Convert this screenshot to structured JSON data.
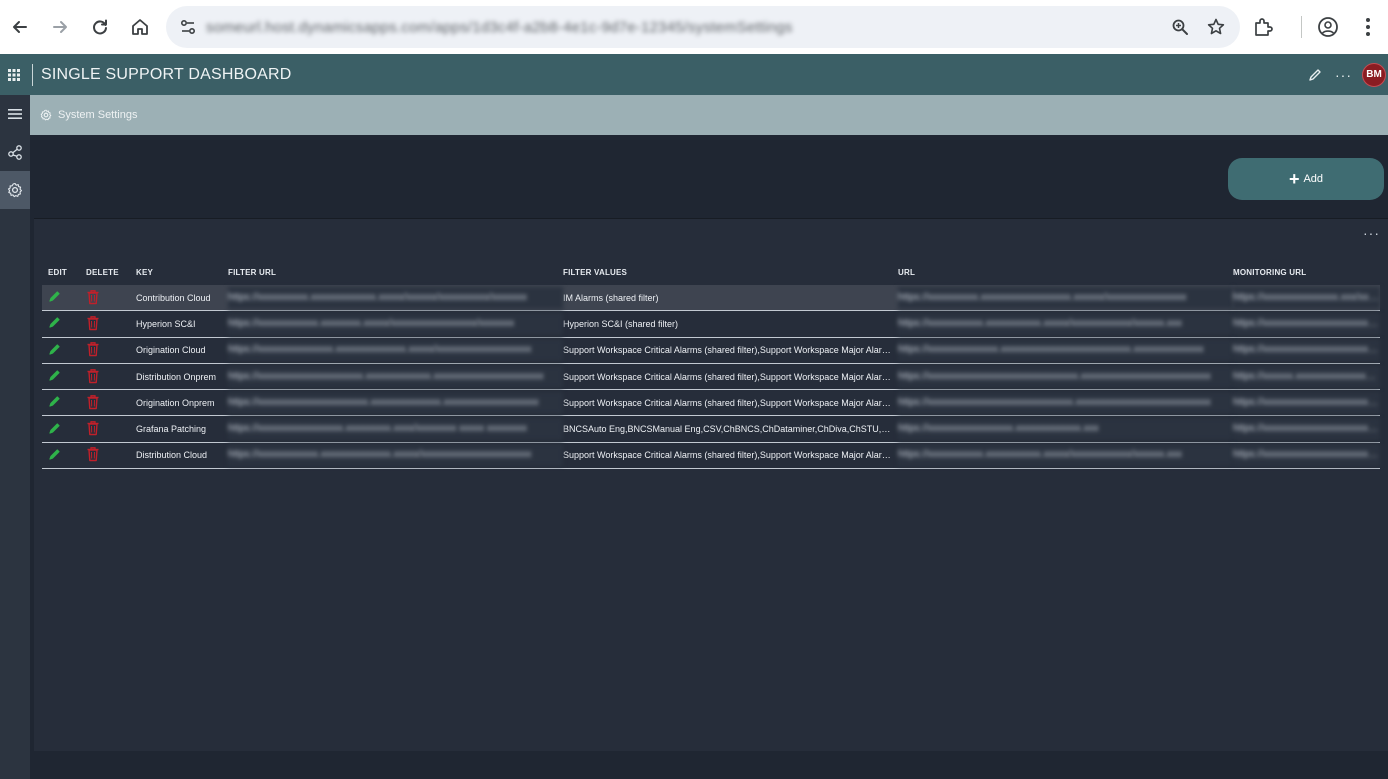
{
  "browser": {
    "url": "someurl.host.dynamicsapps.com/apps/1d3c4f-a2b8-4e1c-9d7e-12345/systemSettings",
    "icons": [
      "back-arrow-icon",
      "forward-arrow-icon",
      "reload-icon",
      "home-icon",
      "site-info-icon",
      "zoom-icon",
      "bookmark-star-icon",
      "extensions-icon",
      "profile-icon",
      "kebab-menu-icon"
    ]
  },
  "app": {
    "title": "SINGLE SUPPORT DASHBOARD",
    "avatar_initials": "BM",
    "brand_color": "#3b5f66",
    "avatar_color": "#8a1c22"
  },
  "breadcrumb": {
    "label": "System Settings"
  },
  "toolbar": {
    "add_label": "Add"
  },
  "table": {
    "columns": {
      "edit": "EDIT",
      "delete": "DELETE",
      "key": "KEY",
      "filter_url": "FILTER URL",
      "filter_values": "FILTER VALUES",
      "url": "URL",
      "monitoring_url": "MONITORING URL"
    },
    "rows": [
      {
        "key": "Contribution Cloud",
        "filter_url": "https://xxxxxxxxxx.xxxxxxxxxxxxx.xxxxx/xxxxxx/xxxxxxxxxx/xxxxxxx",
        "filter_values": "IM Alarms (shared filter)",
        "url": "https://xxxxxxxxxx.xxxxxxxxxxxxxxxxxx.xxxxxx/xxxxxxxxxxxxxxxx",
        "monitoring_url": "https://xxxxxxxxxxxxxxx.xxx/xxxxxx"
      },
      {
        "key": "Hyperion SC&I",
        "filter_url": "https://xxxxxxxxxxxx.xxxxxxxx.xxxxx/xxxxxxxxxxxxxxxxx/xxxxxxx",
        "filter_values": "Hyperion SC&I (shared filter)",
        "url": "https://xxxxxxxxxxx.xxxxxxxxxxx.xxxxx/xxxxxxxxxxxx/xxxxxx.xxx",
        "monitoring_url": "https://xxxxxxxxxxxxxxxxxxxxx.xxx"
      },
      {
        "key": "Origination Cloud",
        "filter_url": "https://xxxxxxxxxxxxxxx.xxxxxxxxxxxxxx.xxxxx/xxxxxxxxxxxxxxxxxxx",
        "filter_values": "Support Workspace Critical Alarms (shared filter),Support Workspace Major Alarms (shared filter)",
        "url": "https://xxxxxxxxxxxxxx.xxxxxxxxxxxxxxxxxxxxxxxxxx.xxxxxxxxxxxxxx",
        "monitoring_url": "https://xxxxxxxxxxxxxxxxxxxxxxxx.xxx"
      },
      {
        "key": "Distribution Onprem",
        "filter_url": "https://xxxxxxxxxxxxxxxxxxxxx.xxxxxxxxxxxxx.xxxxxxxxxxxxxxxxxxxxxx",
        "filter_values": "Support Workspace Critical Alarms (shared filter),Support Workspace Major Alarms (shared filter)",
        "url": "https://xxxxxxxxxxxxxxxxxxxxxxxxxxxxxx.xxxxxxxxxxxxxxxxxxxxxxxxxx",
        "monitoring_url": "https://xxxxxx.xxxxxxxxxxxxxxxxxxxxxx"
      },
      {
        "key": "Origination Onprem",
        "filter_url": "https://xxxxxxxxxxxxxxxxxxxxxx.xxxxxxxxxxxxxx.xxxxxxxxxxxxxxxxxxx",
        "filter_values": "Support Workspace Critical Alarms (shared filter),Support Workspace Major Alarms (shared filter)",
        "url": "https://xxxxxxxxxxxxxxxxxxxxxxxxxxxxx.xxxxxxxxxxxxxxxxxxxxxxxxxxx",
        "monitoring_url": "https://xxxxxxxxxxxxxxxxxxxxxxxxxxxx"
      },
      {
        "key": "Grafana Patching",
        "filter_url": "https://xxxxxxxxxxxxxxxxx.xxxxxxxxx.xxxx/xxxxxxxx xxxxx xxxxxxxx",
        "filter_values": "BNCSAuto Eng,BNCSManual Eng,CSV,ChBNCS,ChDataminer,ChDiva,ChSTU,Dataminer",
        "url": "https://xxxxxxxxxxxxxxxxx.xxxxxxxxxxxxx.xxx",
        "monitoring_url": "https://xxxxxxxxxxxxxxxxxxxxxxxxxxxxxx"
      },
      {
        "key": "Distribution Cloud",
        "filter_url": "https://xxxxxxxxxxxx.xxxxxxxxxxxxxx.xxxxx/xxxxxxxxxxxxxxxxxxxxxx",
        "filter_values": "Support Workspace Critical Alarms (shared filter),Support Workspace Major Alarms (shared filter)",
        "url": "https://xxxxxxxxxxx.xxxxxxxxxxx.xxxxx/xxxxxxxxxxxx/xxxxxx.xxx",
        "monitoring_url": "https://xxxxxxxxxxxxxxxxxxxxxxxxxx"
      }
    ],
    "edit_icon_color": "#2fb34a",
    "delete_icon_color": "#c0202a"
  }
}
